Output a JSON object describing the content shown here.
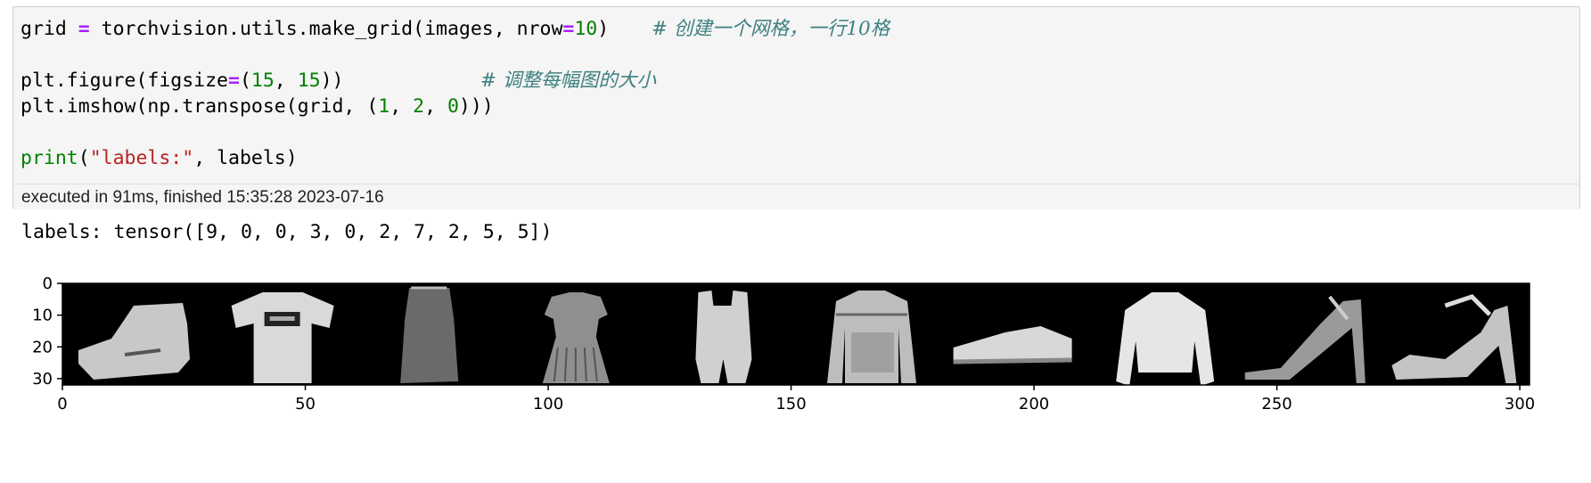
{
  "cell": {
    "lines": [
      {
        "tokens": [
          {
            "t": "grid ",
            "c": "plain"
          },
          {
            "t": "=",
            "c": "op"
          },
          {
            "t": " torchvision.utils.make_grid(images, nrow",
            "c": "plain"
          },
          {
            "t": "=",
            "c": "op"
          },
          {
            "t": "10",
            "c": "num"
          },
          {
            "t": ")",
            "c": "plain"
          }
        ],
        "comment": "# 创建一个网格，一行10格"
      },
      {
        "tokens": [],
        "comment": ""
      },
      {
        "tokens": [
          {
            "t": "plt.figure(figsize",
            "c": "plain"
          },
          {
            "t": "=",
            "c": "op"
          },
          {
            "t": "(",
            "c": "plain"
          },
          {
            "t": "15",
            "c": "num"
          },
          {
            "t": ", ",
            "c": "plain"
          },
          {
            "t": "15",
            "c": "num"
          },
          {
            "t": "))",
            "c": "plain"
          }
        ],
        "comment": "# 调整每幅图的大小"
      },
      {
        "tokens": [
          {
            "t": "plt.imshow(np.transpose(grid, (",
            "c": "plain"
          },
          {
            "t": "1",
            "c": "num"
          },
          {
            "t": ", ",
            "c": "plain"
          },
          {
            "t": "2",
            "c": "num"
          },
          {
            "t": ", ",
            "c": "plain"
          },
          {
            "t": "0",
            "c": "num"
          },
          {
            "t": ")))",
            "c": "plain"
          }
        ],
        "comment": ""
      },
      {
        "tokens": [],
        "comment": ""
      },
      {
        "tokens": [
          {
            "t": "print",
            "c": "bi"
          },
          {
            "t": "(",
            "c": "plain"
          },
          {
            "t": "\"labels:\"",
            "c": "str"
          },
          {
            "t": ", labels)",
            "c": "plain"
          }
        ],
        "comment": ""
      }
    ],
    "execution_info": "executed in 91ms, finished 15:35:28 2023-07-16"
  },
  "output": {
    "text": "labels: tensor([9, 0, 0, 3, 0, 2, 7, 2, 5, 5])"
  },
  "chart_data": {
    "type": "image",
    "x_ticks": [
      0,
      50,
      100,
      150,
      200,
      250,
      300
    ],
    "y_ticks": [
      0,
      10,
      20,
      30
    ],
    "xlim": [
      0,
      302
    ],
    "ylim": [
      32,
      0
    ],
    "grid_columns": 10,
    "labels": [
      9,
      0,
      0,
      3,
      0,
      2,
      7,
      2,
      5,
      5
    ],
    "items": [
      "ankle-boot",
      "t-shirt",
      "t-shirt",
      "dress",
      "t-shirt",
      "pullover",
      "sneaker",
      "pullover",
      "sandal",
      "sandal"
    ]
  },
  "colors": {
    "keyword_op": "#aa22ff",
    "number": "#008000",
    "string": "#ba2121",
    "comment": "#408080",
    "cell_bg": "#f5f5f5"
  }
}
